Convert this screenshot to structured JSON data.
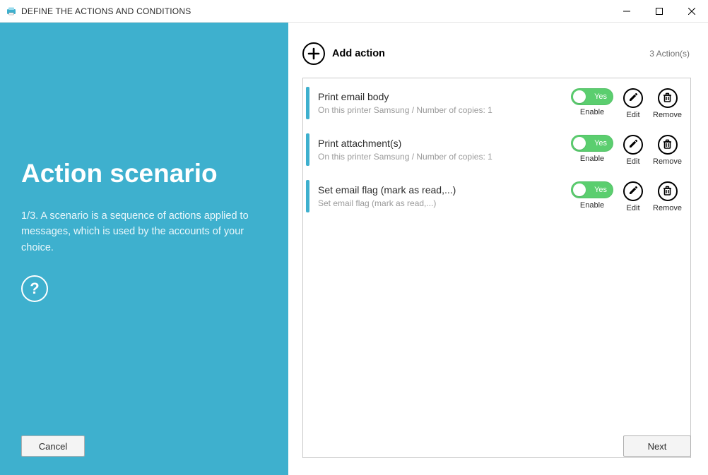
{
  "window": {
    "title": "DEFINE THE ACTIONS AND CONDITIONS"
  },
  "side": {
    "heading": "Action scenario",
    "description": "1/3. A scenario is a sequence of actions applied to messages, which is used by the accounts of your choice.",
    "help_symbol": "?",
    "cancel_label": "Cancel"
  },
  "header": {
    "add_label": "Add action",
    "count_label": "3  Action(s)"
  },
  "labels": {
    "enable": "Enable",
    "edit": "Edit",
    "remove": "Remove",
    "toggle_on": "Yes",
    "next": "Next"
  },
  "actions": [
    {
      "title": "Print email body",
      "subtitle": "On this printer Samsung / Number of copies: 1"
    },
    {
      "title": "Print attachment(s)",
      "subtitle": "On this printer Samsung / Number of copies: 1"
    },
    {
      "title": "Set email flag (mark as read,...)",
      "subtitle": "Set email flag (mark as read,...)"
    }
  ],
  "colors": {
    "accent": "#3eb0ce",
    "toggle_on": "#5bce6f"
  }
}
